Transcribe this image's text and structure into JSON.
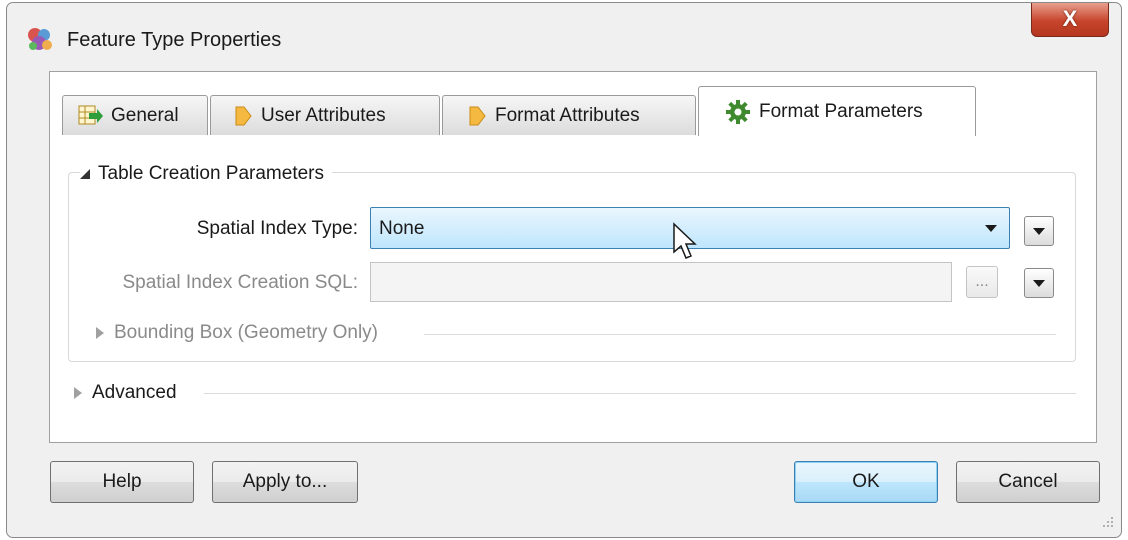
{
  "window": {
    "title": "Feature Type Properties",
    "close_label": "X"
  },
  "tabs": [
    {
      "label": "General",
      "icon": "table-arrow-icon"
    },
    {
      "label": "User Attributes",
      "icon": "attribute-tag-icon"
    },
    {
      "label": "Format Attributes",
      "icon": "attribute-tag-icon"
    },
    {
      "label": "Format Parameters",
      "icon": "gear-icon",
      "active": true
    }
  ],
  "table_creation": {
    "header": "Table Creation Parameters",
    "spatial_index_type": {
      "label": "Spatial Index Type:",
      "value": "None"
    },
    "spatial_index_sql": {
      "label": "Spatial Index Creation SQL:",
      "value": "",
      "ellipsis": "..."
    },
    "bounding_box": {
      "header": "Bounding Box (Geometry Only)"
    }
  },
  "advanced": {
    "header": "Advanced"
  },
  "buttons": {
    "help": "Help",
    "apply_to": "Apply to...",
    "ok": "OK",
    "cancel": "Cancel"
  },
  "colors": {
    "combo_highlight": "#bee6fd",
    "close_button": "#c7442b"
  }
}
